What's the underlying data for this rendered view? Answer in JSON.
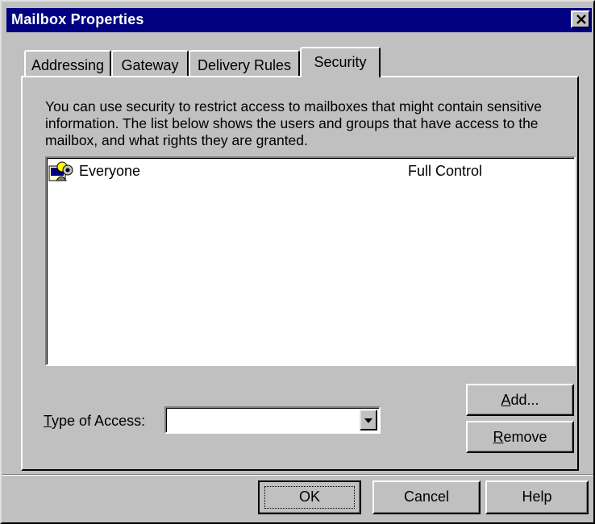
{
  "window": {
    "title": "Mailbox Properties",
    "close_glyph": "✕"
  },
  "tabs": [
    {
      "label": "Addressing",
      "active": false
    },
    {
      "label": "Gateway",
      "active": false
    },
    {
      "label": "Delivery Rules",
      "active": false
    },
    {
      "label": "Security",
      "active": true
    }
  ],
  "security": {
    "description": "You can use security to restrict access to mailboxes that might contain sensitive information. The list below shows the users and groups that have access to the mailbox, and what rights they are granted.",
    "entries": [
      {
        "icon": "users-group-icon",
        "name": "Everyone",
        "rights": "Full Control"
      }
    ],
    "type_of_access": {
      "label_accel": "T",
      "label_rest": "ype of Access:",
      "value": ""
    },
    "add": {
      "accel": "A",
      "rest": "dd..."
    },
    "remove": {
      "accel": "R",
      "rest": "emove"
    }
  },
  "footer": {
    "ok_label": "OK",
    "cancel_label": "Cancel",
    "help_label": "Help"
  },
  "colors": {
    "titlebar": "#000080",
    "face": "#c0c0c0"
  }
}
